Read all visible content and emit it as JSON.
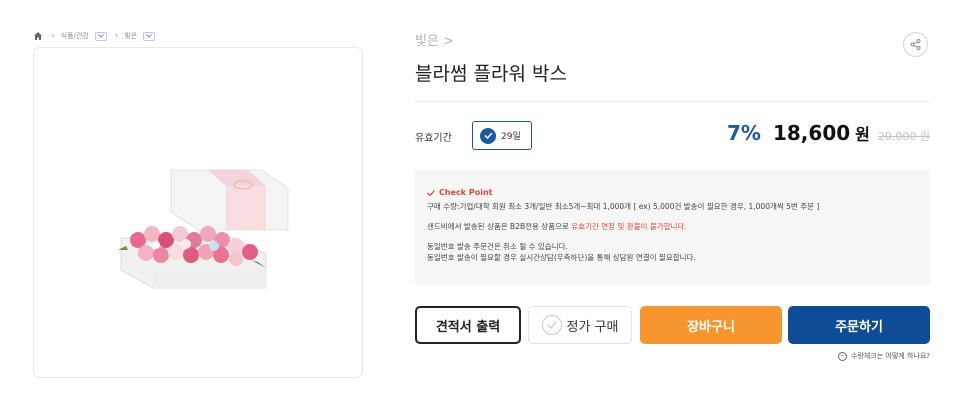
{
  "breadcrumb": {
    "home_icon": "home-icon",
    "category": "식품/건강",
    "subcategory": "빛은"
  },
  "product": {
    "brand_link": "빛은 >",
    "title": "블라썸 플라워 박스",
    "image_alt": "flower box"
  },
  "share": {
    "icon": "share-icon"
  },
  "expiry": {
    "label": "유효기간",
    "selected_option": "29일"
  },
  "pricing": {
    "discount": "7%",
    "price": "18,600",
    "currency": "원",
    "original_price": "20,000 원"
  },
  "notice": {
    "title": "Check Point",
    "line1": "구매 수량:기업/대학 회원 최소 3개/일반 최소5개~최대 1,000개 [ ex) 5,000건 발송이 필요한 경우, 1,000개씩 5번 주문 ]",
    "line2_prefix": "샌드비에서 발송된 상품은 B2B전용 상품으로 ",
    "line2_highlight": "유효기간 연장 및 환불이 불가합니다.",
    "line3": "동일번호 발송 주문건은 취소 될 수 있습니다.",
    "line4": "동일번호 발송이 필요할 경우 실시간상담(우측하단)을 통해 상담원 연결이 필요합니다."
  },
  "buttons": {
    "quote": "견적서 출력",
    "regular": "정가 구매",
    "cart": "장바구니",
    "order": "주문하기"
  },
  "help": {
    "text": "수량체크는 어떻게 하나요?"
  },
  "colors": {
    "primary": "#1d5aa6",
    "order_button": "#0f4c97",
    "cart_button": "#f7952e",
    "alert_red": "#e0443f"
  }
}
